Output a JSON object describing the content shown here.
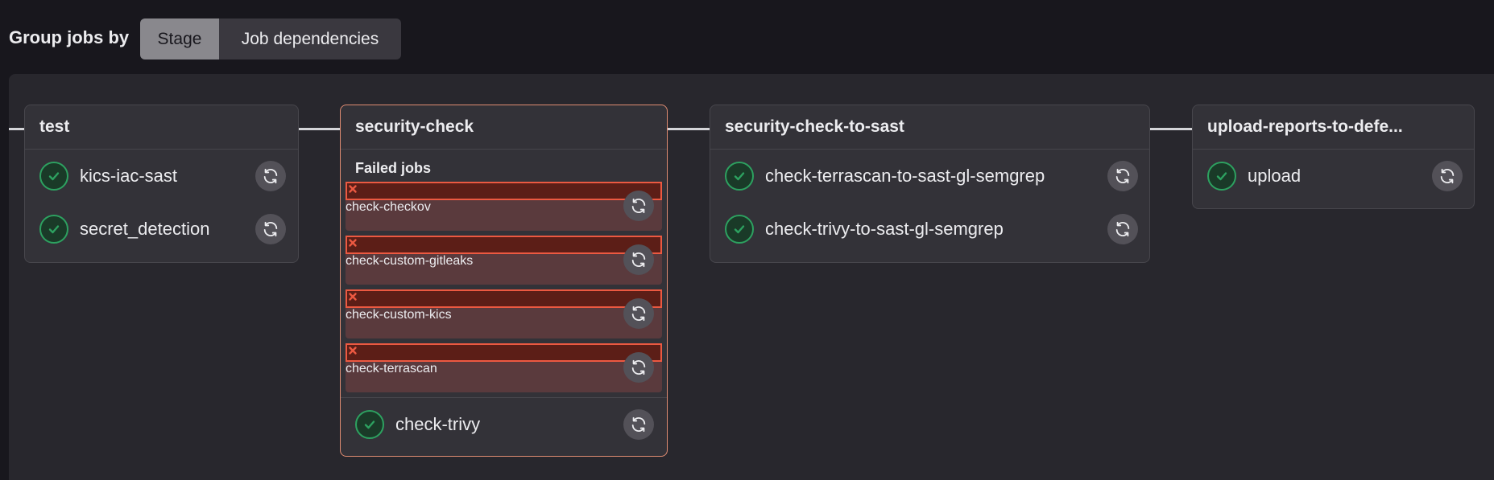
{
  "toolbar": {
    "group_label": "Group jobs by",
    "options": [
      {
        "label": "Stage",
        "selected": true
      },
      {
        "label": "Job dependencies",
        "selected": false
      }
    ]
  },
  "colors": {
    "success": "#2da160",
    "failed": "#ec5941",
    "failed_row_bg": "#5a3a3d",
    "failed_stage_border": "#e08c72"
  },
  "stages": [
    {
      "title": "test",
      "jobs": [
        {
          "name": "kics-iac-sast",
          "status": "success",
          "status_icon": "check-circle-icon",
          "action_icon": "retry-icon"
        },
        {
          "name": "secret_detection",
          "status": "success",
          "status_icon": "check-circle-icon",
          "action_icon": "retry-icon"
        }
      ]
    },
    {
      "title": "security-check",
      "failed_header": "Failed jobs",
      "failed_jobs": [
        {
          "name": "check-checkov",
          "status": "failed",
          "status_icon": "x-circle-icon",
          "action_icon": "retry-icon"
        },
        {
          "name": "check-custom-gitleaks",
          "status": "failed",
          "status_icon": "x-circle-icon",
          "action_icon": "retry-icon"
        },
        {
          "name": "check-custom-kics",
          "status": "failed",
          "status_icon": "x-circle-icon",
          "action_icon": "retry-icon"
        },
        {
          "name": "check-terrascan",
          "status": "failed",
          "status_icon": "x-circle-icon",
          "action_icon": "retry-icon"
        }
      ],
      "jobs": [
        {
          "name": "check-trivy",
          "status": "success",
          "status_icon": "check-circle-icon",
          "action_icon": "retry-icon"
        }
      ]
    },
    {
      "title": "security-check-to-sast",
      "jobs": [
        {
          "name": "check-terrascan-to-sast-gl-semgrep",
          "status": "success",
          "status_icon": "check-circle-icon",
          "action_icon": "retry-icon"
        },
        {
          "name": "check-trivy-to-sast-gl-semgrep",
          "status": "success",
          "status_icon": "check-circle-icon",
          "action_icon": "retry-icon"
        }
      ]
    },
    {
      "title": "upload-reports-to-defe...",
      "jobs": [
        {
          "name": "upload",
          "status": "success",
          "status_icon": "check-circle-icon",
          "action_icon": "retry-icon"
        }
      ]
    }
  ]
}
